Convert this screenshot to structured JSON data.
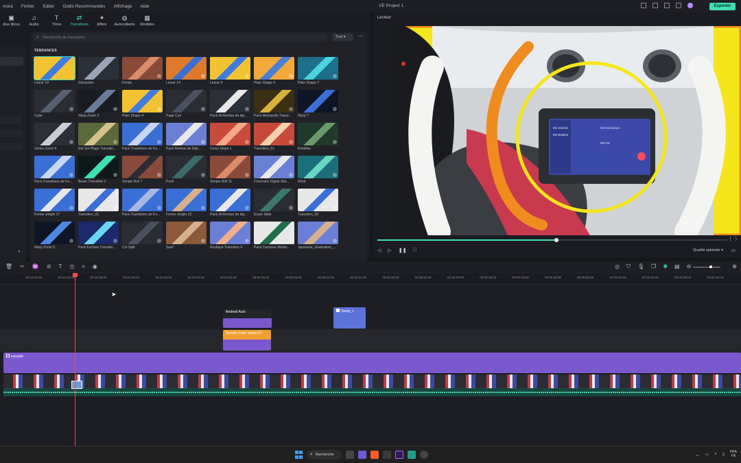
{
  "menu": {
    "items": [
      "mora",
      "Fichier",
      "Editer",
      "Outils Recommandés",
      "Affichage",
      "Aide"
    ],
    "project_title": "VE Project 1",
    "export_label": "Exporter"
  },
  "tabs": [
    {
      "label": "dias libres",
      "icon": "media-icon"
    },
    {
      "label": "Audio",
      "icon": "music-note-icon"
    },
    {
      "label": "Titres",
      "icon": "text-icon"
    },
    {
      "label": "Transitions",
      "icon": "transitions-icon",
      "active": true
    },
    {
      "label": "Effets",
      "icon": "effects-icon"
    },
    {
      "label": "Autocollants",
      "icon": "sticker-icon"
    },
    {
      "label": "Modèles",
      "icon": "templates-icon"
    }
  ],
  "library": {
    "search_placeholder": "Recherche de transitions",
    "filter_label": "Tout",
    "section_title": "TENDANCES",
    "items": [
      "Linear 19",
      "Dissoudre",
      "Fondu",
      "Linear 14",
      "Linear 4",
      "Plain Shape 8",
      "Plain Shape 7",
      "Cube",
      "Warp Zoom 3",
      "Plain Shape 4",
      "Page Curl",
      "Pack IA Remise de dip...",
      "Pack Metropolis Transi...",
      "Warp 7",
      "Vortex Zoom 6",
      "Été Set Plage Transitio...",
      "Pack Transitions de Fo...",
      "Pack Remise de Dipl...",
      "Cross Stripe 1",
      "Transition_01",
      "Entailles",
      "Pack Transitions de Fo...",
      "Beam Transition 3",
      "Simple Roll 7",
      "Push",
      "Simple Roll 11",
      "Cinematic Digital Slid...",
      "Wind",
      "Forme simple 17",
      "Transition_01",
      "Pack Transitions de Fo...",
      "Forme simple 22",
      "Pack IA Remise de dip...",
      "Erase Slide",
      "Transition_05",
      "Warp Zoom 5",
      "Pack Fuchsia Transitio...",
      "Col Split",
      "Swirl",
      "Rustique Transition 4",
      "Pack Campeur Moder...",
      "Japanese_Graduation_..."
    ]
  },
  "player": {
    "title": "Lecteur",
    "quality_label": "Qualité optimale",
    "progress_fraction": 0.51,
    "screen_text": [
      "Ms Sandra",
      "Ms Bastian",
      "Ms Dominique",
      "Ms Oui"
    ]
  },
  "timeline": {
    "ruler": [
      "00:04:25:00",
      "00:04:30:00",
      "00:04:35:00",
      "00:04:40:00",
      "00:04:45:00",
      "00:04:50:00",
      "00:04:55:00",
      "00:05:00:00",
      "00:05:05:00",
      "00:05:10:00",
      "00:05:15:00",
      "00:05:20:00",
      "00:05:25:00",
      "00:05:30:00",
      "00:05:35:00",
      "00:05:40:00",
      "00:05:45:00",
      "00:05:50:00",
      "00:05:55:00",
      "00:06:00:00",
      "00:06:05:00",
      "00:06:10:00"
    ],
    "clips": {
      "android": "Android Auto",
      "title": "Vanity_1",
      "orange": "Sample Color Sweet 01",
      "purple": "encadré"
    }
  },
  "taskbar": {
    "search_label": "Recherche",
    "lang": "FRA",
    "lang_sub": "FR"
  }
}
